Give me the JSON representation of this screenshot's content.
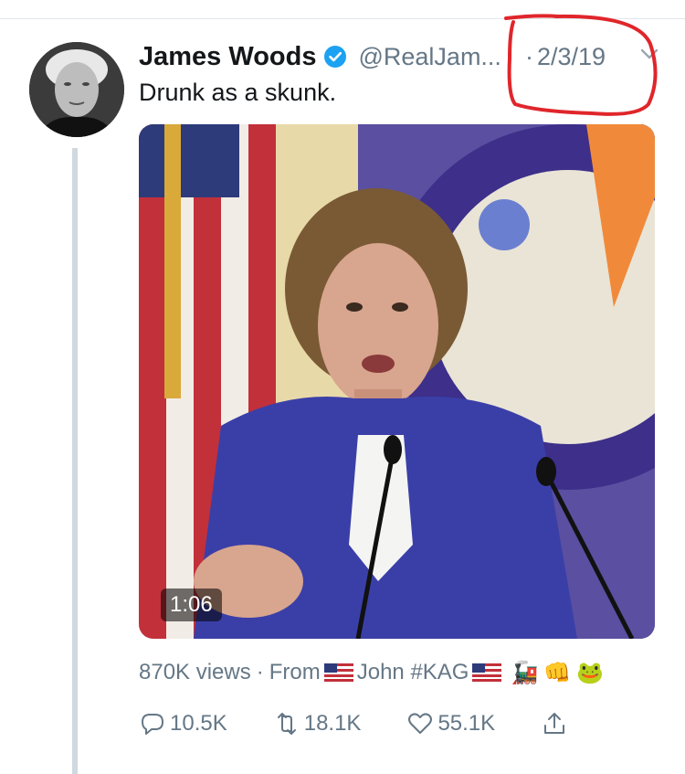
{
  "tweet": {
    "author": {
      "display_name": "James Woods",
      "handle": "@RealJam...",
      "verified": true
    },
    "separator": "·",
    "timestamp": "2/3/19",
    "text": "Drunk as a skunk.",
    "video": {
      "duration": "1:06"
    },
    "views": "870K views",
    "source_prefix": "From",
    "source_name": "John #KAG",
    "source_emojis": [
      "🚂",
      "👊",
      "🐸"
    ],
    "stats": {
      "replies": "10.5K",
      "retweets": "18.1K",
      "likes": "55.1K"
    }
  },
  "colors": {
    "text_primary": "#14171a",
    "text_secondary": "#657786",
    "verified_blue": "#1da1f2",
    "annotation_red": "#e0262b",
    "thread_line": "#cfd9de"
  },
  "icons": {
    "verified": "verified-badge-icon",
    "caret": "chevron-down-icon",
    "reply": "reply-icon",
    "retweet": "retweet-icon",
    "like": "heart-icon",
    "share": "share-icon"
  }
}
